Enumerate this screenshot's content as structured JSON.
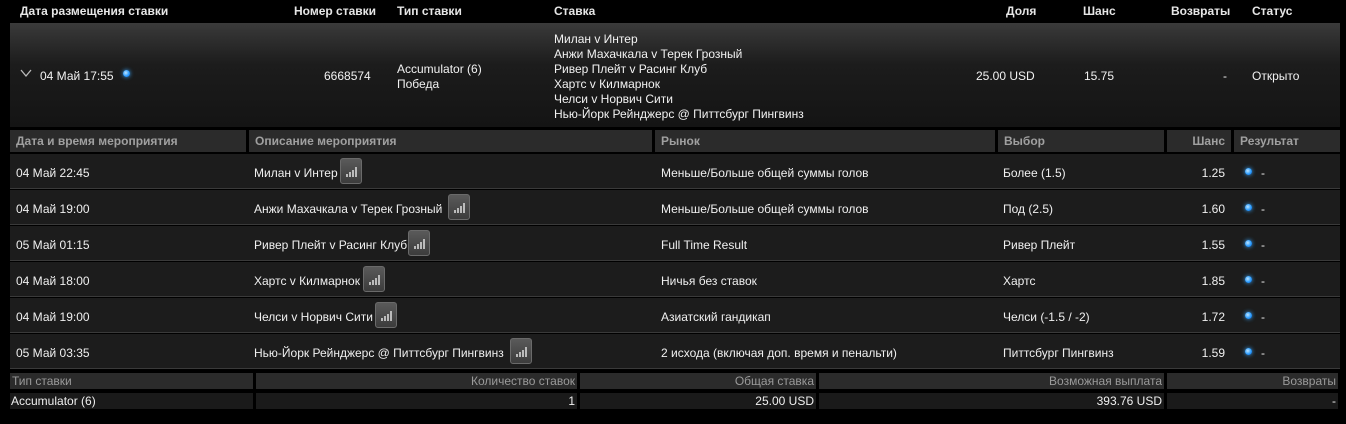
{
  "header": {
    "date_placed": "Дата размещения ставки",
    "bet_number": "Номер ставки",
    "bet_type": "Тип ставки",
    "bet": "Ставка",
    "stake": "Доля",
    "odds": "Шанс",
    "returns": "Возвраты",
    "status": "Статус"
  },
  "summary": {
    "date": "04 Май 17:55",
    "bet_number": "6668574",
    "bet_type_line1": "Accumulator (6)",
    "bet_type_line2": "Победа",
    "selections": [
      "Милан v Интер",
      "Анжи Махачкала v Терек Грозный",
      "Ривер Плейт v Расинг Клуб",
      "Хартс v Килмарнок",
      "Челси v Норвич Сити",
      "Нью-Йорк Рейнджерс @ Питтсбург Пингвинз"
    ],
    "stake": "25.00 USD",
    "odds": "15.75",
    "returns": "-",
    "status": "Открыто"
  },
  "detail_header": {
    "datetime": "Дата и время мероприятия",
    "description": "Описание мероприятия",
    "market": "Рынок",
    "selection": "Выбор",
    "odds": "Шанс",
    "result": "Результат"
  },
  "events": [
    {
      "datetime": "04 Май 22:45",
      "description": "Милан v Интер",
      "market": "Меньше/Больше общей суммы голов",
      "selection": "Более (1.5)",
      "odds": "1.25",
      "result": "-"
    },
    {
      "datetime": "04 Май 19:00",
      "description": "Анжи Махачкала v Терек Грозный",
      "market": "Меньше/Больше общей суммы голов",
      "selection": "Под (2.5)",
      "odds": "1.60",
      "result": "-"
    },
    {
      "datetime": "05 Май 01:15",
      "description": "Ривер Плейт v Расинг Клуб",
      "market": "Full Time Result",
      "selection": "Ривер Плейт",
      "odds": "1.55",
      "result": "-"
    },
    {
      "datetime": "04 Май 18:00",
      "description": "Хартс v Килмарнок",
      "market": "Ничья без ставок",
      "selection": "Хартс",
      "odds": "1.85",
      "result": "-"
    },
    {
      "datetime": "04 Май 19:00",
      "description": "Челси v Норвич Сити",
      "market": "Азиатский гандикап",
      "selection": "Челси (-1.5 / -2)",
      "odds": "1.72",
      "result": "-"
    },
    {
      "datetime": "05 Май 03:35",
      "description": "Нью-Йорк Рейнджерс @ Питтсбург Пингвинз",
      "market": "2 исхода (включая доп. время и пенальти)",
      "selection": "Питтсбург Пингвинз",
      "odds": "1.59",
      "result": "-"
    }
  ],
  "footer_header": {
    "bet_type": "Тип ставки",
    "count": "Количество ставок",
    "total_stake": "Общая ставка",
    "possible_payout": "Возможная выплата",
    "returns": "Возвраты"
  },
  "footer": {
    "bet_type": "Accumulator (6)",
    "count": "1",
    "total_stake": "25.00 USD",
    "possible_payout": "393.76 USD",
    "returns": "-"
  },
  "colors": {
    "background": "#000000",
    "row": "#1c1c1c",
    "header": "#2b2b2b",
    "status_dot": "#2a9cff"
  },
  "icons": {
    "expand": "chevron-down-icon",
    "stats": "stats-bars-icon",
    "status": "status-dot-icon"
  }
}
